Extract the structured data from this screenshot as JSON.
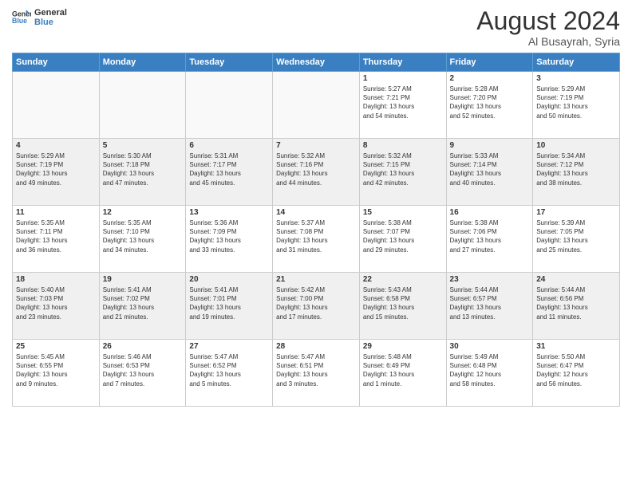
{
  "logo": {
    "line1": "General",
    "line2": "Blue"
  },
  "header": {
    "month": "August 2024",
    "location": "Al Busayrah, Syria"
  },
  "weekdays": [
    "Sunday",
    "Monday",
    "Tuesday",
    "Wednesday",
    "Thursday",
    "Friday",
    "Saturday"
  ],
  "weeks": [
    [
      {
        "day": "",
        "info": ""
      },
      {
        "day": "",
        "info": ""
      },
      {
        "day": "",
        "info": ""
      },
      {
        "day": "",
        "info": ""
      },
      {
        "day": "1",
        "info": "Sunrise: 5:27 AM\nSunset: 7:21 PM\nDaylight: 13 hours\nand 54 minutes."
      },
      {
        "day": "2",
        "info": "Sunrise: 5:28 AM\nSunset: 7:20 PM\nDaylight: 13 hours\nand 52 minutes."
      },
      {
        "day": "3",
        "info": "Sunrise: 5:29 AM\nSunset: 7:19 PM\nDaylight: 13 hours\nand 50 minutes."
      }
    ],
    [
      {
        "day": "4",
        "info": "Sunrise: 5:29 AM\nSunset: 7:19 PM\nDaylight: 13 hours\nand 49 minutes."
      },
      {
        "day": "5",
        "info": "Sunrise: 5:30 AM\nSunset: 7:18 PM\nDaylight: 13 hours\nand 47 minutes."
      },
      {
        "day": "6",
        "info": "Sunrise: 5:31 AM\nSunset: 7:17 PM\nDaylight: 13 hours\nand 45 minutes."
      },
      {
        "day": "7",
        "info": "Sunrise: 5:32 AM\nSunset: 7:16 PM\nDaylight: 13 hours\nand 44 minutes."
      },
      {
        "day": "8",
        "info": "Sunrise: 5:32 AM\nSunset: 7:15 PM\nDaylight: 13 hours\nand 42 minutes."
      },
      {
        "day": "9",
        "info": "Sunrise: 5:33 AM\nSunset: 7:14 PM\nDaylight: 13 hours\nand 40 minutes."
      },
      {
        "day": "10",
        "info": "Sunrise: 5:34 AM\nSunset: 7:12 PM\nDaylight: 13 hours\nand 38 minutes."
      }
    ],
    [
      {
        "day": "11",
        "info": "Sunrise: 5:35 AM\nSunset: 7:11 PM\nDaylight: 13 hours\nand 36 minutes."
      },
      {
        "day": "12",
        "info": "Sunrise: 5:35 AM\nSunset: 7:10 PM\nDaylight: 13 hours\nand 34 minutes."
      },
      {
        "day": "13",
        "info": "Sunrise: 5:36 AM\nSunset: 7:09 PM\nDaylight: 13 hours\nand 33 minutes."
      },
      {
        "day": "14",
        "info": "Sunrise: 5:37 AM\nSunset: 7:08 PM\nDaylight: 13 hours\nand 31 minutes."
      },
      {
        "day": "15",
        "info": "Sunrise: 5:38 AM\nSunset: 7:07 PM\nDaylight: 13 hours\nand 29 minutes."
      },
      {
        "day": "16",
        "info": "Sunrise: 5:38 AM\nSunset: 7:06 PM\nDaylight: 13 hours\nand 27 minutes."
      },
      {
        "day": "17",
        "info": "Sunrise: 5:39 AM\nSunset: 7:05 PM\nDaylight: 13 hours\nand 25 minutes."
      }
    ],
    [
      {
        "day": "18",
        "info": "Sunrise: 5:40 AM\nSunset: 7:03 PM\nDaylight: 13 hours\nand 23 minutes."
      },
      {
        "day": "19",
        "info": "Sunrise: 5:41 AM\nSunset: 7:02 PM\nDaylight: 13 hours\nand 21 minutes."
      },
      {
        "day": "20",
        "info": "Sunrise: 5:41 AM\nSunset: 7:01 PM\nDaylight: 13 hours\nand 19 minutes."
      },
      {
        "day": "21",
        "info": "Sunrise: 5:42 AM\nSunset: 7:00 PM\nDaylight: 13 hours\nand 17 minutes."
      },
      {
        "day": "22",
        "info": "Sunrise: 5:43 AM\nSunset: 6:58 PM\nDaylight: 13 hours\nand 15 minutes."
      },
      {
        "day": "23",
        "info": "Sunrise: 5:44 AM\nSunset: 6:57 PM\nDaylight: 13 hours\nand 13 minutes."
      },
      {
        "day": "24",
        "info": "Sunrise: 5:44 AM\nSunset: 6:56 PM\nDaylight: 13 hours\nand 11 minutes."
      }
    ],
    [
      {
        "day": "25",
        "info": "Sunrise: 5:45 AM\nSunset: 6:55 PM\nDaylight: 13 hours\nand 9 minutes."
      },
      {
        "day": "26",
        "info": "Sunrise: 5:46 AM\nSunset: 6:53 PM\nDaylight: 13 hours\nand 7 minutes."
      },
      {
        "day": "27",
        "info": "Sunrise: 5:47 AM\nSunset: 6:52 PM\nDaylight: 13 hours\nand 5 minutes."
      },
      {
        "day": "28",
        "info": "Sunrise: 5:47 AM\nSunset: 6:51 PM\nDaylight: 13 hours\nand 3 minutes."
      },
      {
        "day": "29",
        "info": "Sunrise: 5:48 AM\nSunset: 6:49 PM\nDaylight: 13 hours\nand 1 minute."
      },
      {
        "day": "30",
        "info": "Sunrise: 5:49 AM\nSunset: 6:48 PM\nDaylight: 12 hours\nand 58 minutes."
      },
      {
        "day": "31",
        "info": "Sunrise: 5:50 AM\nSunset: 6:47 PM\nDaylight: 12 hours\nand 56 minutes."
      }
    ]
  ]
}
